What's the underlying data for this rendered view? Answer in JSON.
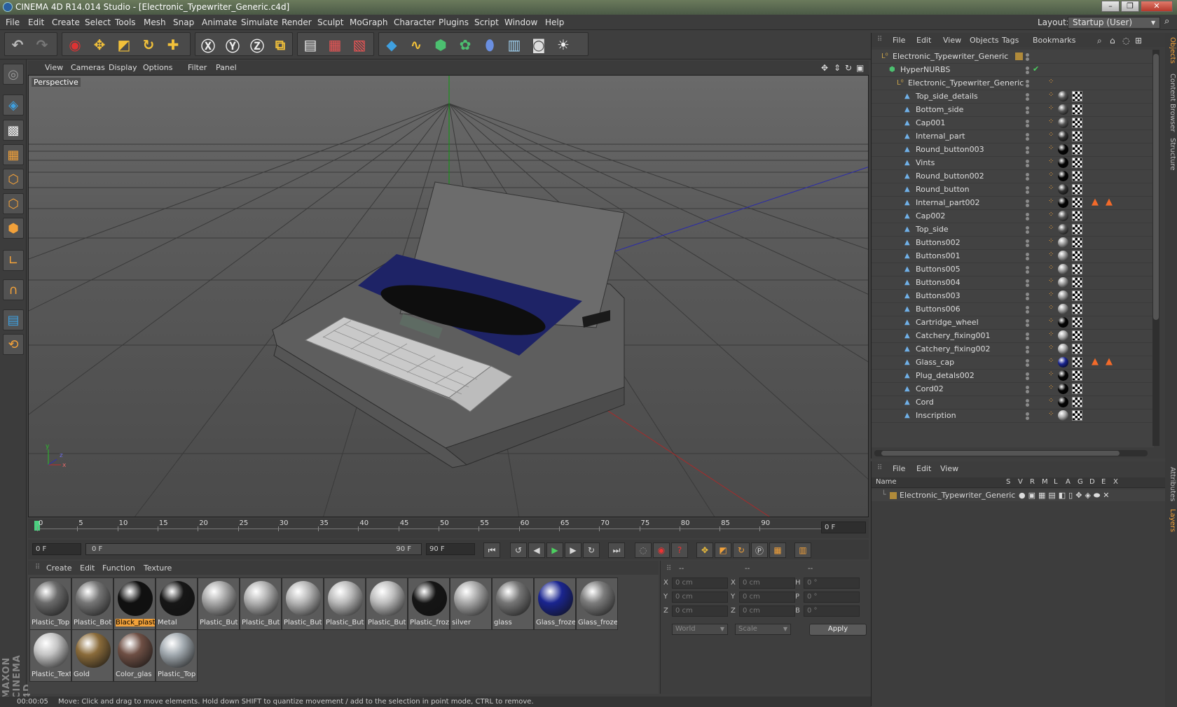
{
  "window": {
    "title": "CINEMA 4D R14.014 Studio - [Electronic_Typewriter_Generic.c4d]",
    "buttons": [
      "–",
      "❐",
      "✕"
    ]
  },
  "menu": [
    "File",
    "Edit",
    "Create",
    "Select",
    "Tools",
    "Mesh",
    "Snap",
    "Animate",
    "Simulate",
    "Render",
    "Sculpt",
    "MoGraph",
    "Character",
    "Plugins",
    "Script",
    "Window",
    "Help"
  ],
  "layout": {
    "label": "Layout:",
    "value": "Startup (User)"
  },
  "viewport": {
    "menu": [
      "View",
      "Cameras",
      "Display",
      "Options",
      "Filter",
      "Panel"
    ],
    "label": "Perspective",
    "axis": {
      "y": "y",
      "z": "z",
      "x": "x"
    }
  },
  "timeline": {
    "ticks": [
      "0",
      "5",
      "10",
      "15",
      "20",
      "25",
      "30",
      "35",
      "40",
      "45",
      "50",
      "55",
      "60",
      "65",
      "70",
      "75",
      "80",
      "85",
      "90"
    ],
    "current_frame": "0 F"
  },
  "transport": {
    "start": "0 F",
    "range_start": "0 F",
    "range_end": "90 F",
    "end": "90 F"
  },
  "materials": {
    "menu": [
      "Create",
      "Edit",
      "Function",
      "Texture"
    ],
    "items": [
      {
        "name": "Plastic_Top",
        "color": "#6b6b6b"
      },
      {
        "name": "Plastic_Bot",
        "color": "#767676"
      },
      {
        "name": "Black_plast",
        "color": "#101010",
        "selected": true
      },
      {
        "name": "Metal",
        "color": "#161616"
      },
      {
        "name": "Plastic_But",
        "color": "#a9a9a9"
      },
      {
        "name": "Plastic_But",
        "color": "#b1b1b1"
      },
      {
        "name": "Plastic_But",
        "color": "#b5b5b5"
      },
      {
        "name": "Plastic_But",
        "color": "#b9b9b9"
      },
      {
        "name": "Plastic_But",
        "color": "#bdbdbd"
      },
      {
        "name": "Plastic_froz",
        "color": "#151515"
      },
      {
        "name": "silver",
        "color": "#a8a8a8"
      },
      {
        "name": "glass",
        "color": "#767676"
      },
      {
        "name": "Glass_froze",
        "color": "#1a2590"
      },
      {
        "name": "Glass_froze",
        "color": "#7c7c7c"
      },
      {
        "name": "Plastic_Text",
        "color": "#c4c4c4"
      },
      {
        "name": "Gold",
        "color": "#8a6b3a"
      },
      {
        "name": "Color_glas",
        "color": "#6e4f44"
      },
      {
        "name": "Plastic_Top",
        "color": "#a2aab0"
      }
    ]
  },
  "coords": {
    "header": [
      "--",
      "--",
      "--"
    ],
    "rows": [
      {
        "a": "X",
        "av": "0 cm",
        "b": "X",
        "bv": "0 cm",
        "c": "H",
        "cv": "0 °"
      },
      {
        "a": "Y",
        "av": "0 cm",
        "b": "Y",
        "bv": "0 cm",
        "c": "P",
        "cv": "0 °"
      },
      {
        "a": "Z",
        "av": "0 cm",
        "b": "Z",
        "bv": "0 cm",
        "c": "B",
        "cv": "0 °"
      }
    ],
    "mode1": "World",
    "mode2": "Scale",
    "apply": "Apply"
  },
  "status": {
    "time": "00:00:05",
    "message": "Move: Click and drag to move elements. Hold down SHIFT to quantize movement / add to the selection in point mode, CTRL to remove."
  },
  "objects": {
    "menu": [
      "File",
      "Edit",
      "View",
      "Objects",
      "Tags",
      "Bookmarks"
    ],
    "tree": [
      {
        "name": "Electronic_Typewriter_Generic",
        "indent": 0,
        "kind": "null"
      },
      {
        "name": "HyperNURBS",
        "indent": 1,
        "kind": "nurbs"
      },
      {
        "name": "Electronic_Typewriter_Generic",
        "indent": 2,
        "kind": "null"
      },
      {
        "name": "Top_side_details",
        "indent": 3,
        "kind": "poly",
        "tag": "#555"
      },
      {
        "name": "Bottom_side",
        "indent": 3,
        "kind": "poly",
        "tag": "#555"
      },
      {
        "name": "Cap001",
        "indent": 3,
        "kind": "poly",
        "tag": "#555"
      },
      {
        "name": "Internal_part",
        "indent": 3,
        "kind": "poly",
        "tag": "#333"
      },
      {
        "name": "Round_button003",
        "indent": 3,
        "kind": "poly",
        "tag": "#050505"
      },
      {
        "name": "Vints",
        "indent": 3,
        "kind": "poly",
        "tag": "#050505"
      },
      {
        "name": "Round_button002",
        "indent": 3,
        "kind": "poly",
        "tag": "#050505"
      },
      {
        "name": "Round_button",
        "indent": 3,
        "kind": "poly",
        "tag": "#333"
      },
      {
        "name": "Internal_part002",
        "indent": 3,
        "kind": "poly",
        "tag": "#050505",
        "extra": true
      },
      {
        "name": "Cap002",
        "indent": 3,
        "kind": "poly",
        "tag": "#555"
      },
      {
        "name": "Top_side",
        "indent": 3,
        "kind": "poly",
        "tag": "#555"
      },
      {
        "name": "Buttons002",
        "indent": 3,
        "kind": "poly",
        "tag": "#999"
      },
      {
        "name": "Buttons001",
        "indent": 3,
        "kind": "poly",
        "tag": "#999"
      },
      {
        "name": "Buttons005",
        "indent": 3,
        "kind": "poly",
        "tag": "#999"
      },
      {
        "name": "Buttons004",
        "indent": 3,
        "kind": "poly",
        "tag": "#999"
      },
      {
        "name": "Buttons003",
        "indent": 3,
        "kind": "poly",
        "tag": "#999"
      },
      {
        "name": "Buttons006",
        "indent": 3,
        "kind": "poly",
        "tag": "#999"
      },
      {
        "name": "Cartridge_wheel",
        "indent": 3,
        "kind": "poly",
        "tag": "#050505"
      },
      {
        "name": "Catchery_fixing001",
        "indent": 3,
        "kind": "poly",
        "tag": "#aaa"
      },
      {
        "name": "Catchery_fixing002",
        "indent": 3,
        "kind": "poly",
        "tag": "#aaa"
      },
      {
        "name": "Glass_cap",
        "indent": 3,
        "kind": "poly",
        "tag": "#1a2590",
        "extra": true
      },
      {
        "name": "Plug_detals002",
        "indent": 3,
        "kind": "poly",
        "tag": "#050505"
      },
      {
        "name": "Cord02",
        "indent": 3,
        "kind": "poly",
        "tag": "#050505"
      },
      {
        "name": "Cord",
        "indent": 3,
        "kind": "poly",
        "tag": "#050505"
      },
      {
        "name": "Inscription",
        "indent": 3,
        "kind": "poly",
        "tag": "#aaa"
      }
    ]
  },
  "layers": {
    "menu": [
      "File",
      "Edit",
      "View"
    ],
    "columns": [
      "Name",
      "S",
      "V",
      "R",
      "M",
      "L",
      "A",
      "G",
      "D",
      "E",
      "X"
    ],
    "rows": [
      {
        "name": "Electronic_Typewriter_Generic"
      }
    ]
  },
  "sidetabs": [
    "Objects",
    "Content Browser",
    "Structure",
    "Attributes",
    "Layers"
  ],
  "brand": "MAXON CINEMA 4D"
}
